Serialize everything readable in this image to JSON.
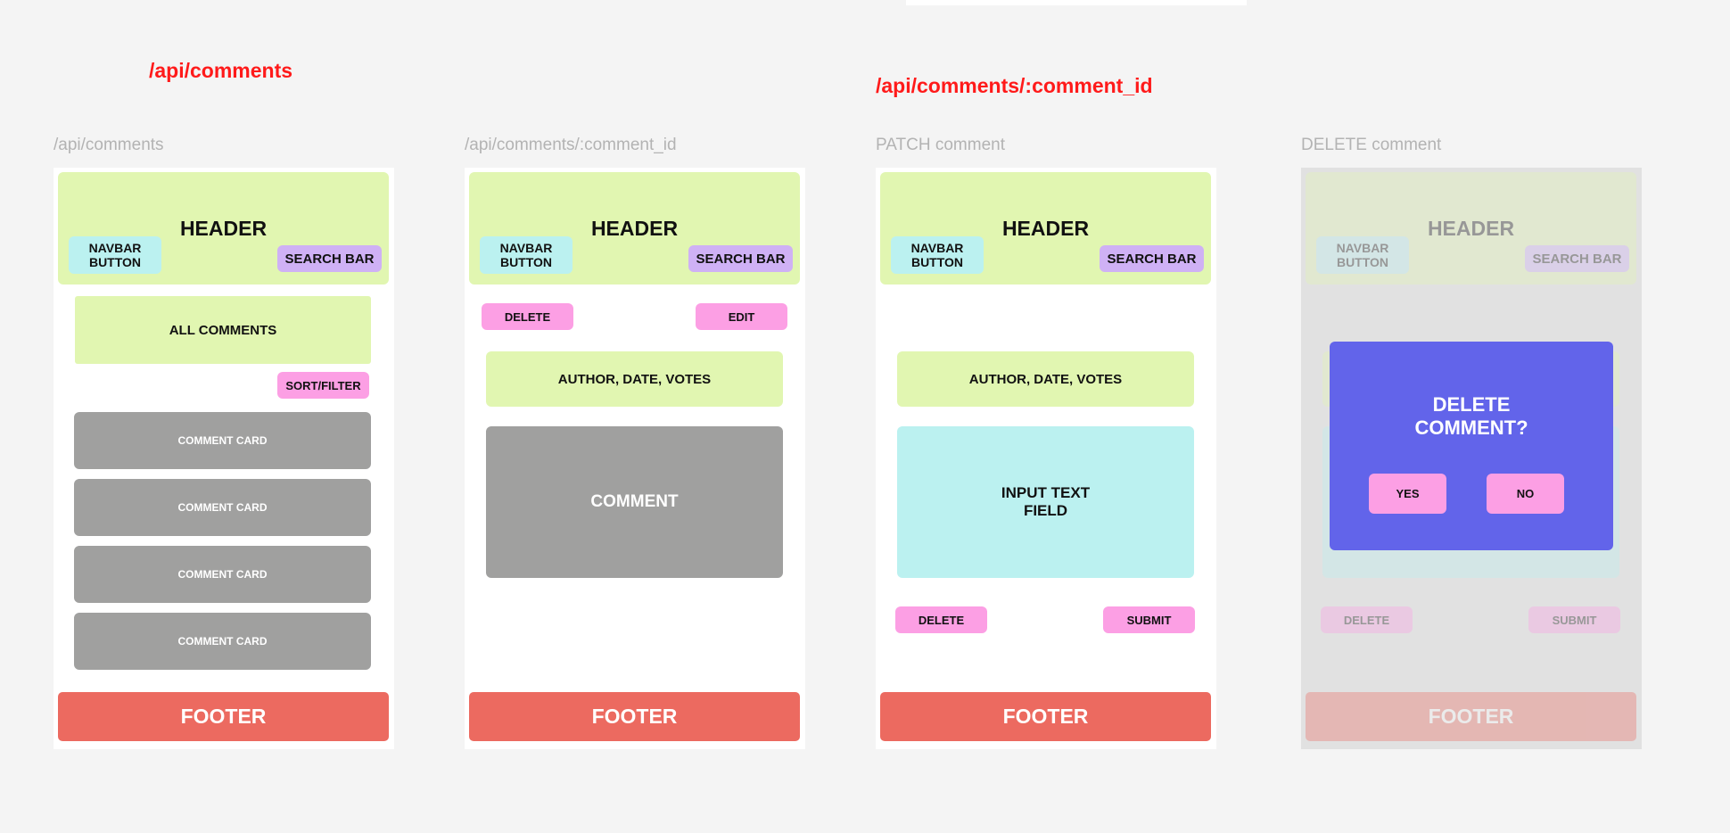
{
  "section_titles": {
    "left": "/api/comments",
    "right": "/api/comments/:comment_id"
  },
  "frames": {
    "list": {
      "label": "/api/comments",
      "header_title": "HEADER",
      "navbar_button": "NAVBAR BUTTON",
      "search_bar": "SEARCH BAR",
      "all_comments": "ALL COMMENTS",
      "sort_filter": "SORT/FILTER",
      "comment_cards": [
        "COMMENT CARD",
        "COMMENT CARD",
        "COMMENT CARD",
        "COMMENT CARD"
      ],
      "footer": "FOOTER"
    },
    "detail": {
      "label": "/api/comments/:comment_id",
      "header_title": "HEADER",
      "navbar_button": "NAVBAR BUTTON",
      "search_bar": "SEARCH BAR",
      "delete": "DELETE",
      "edit": "EDIT",
      "meta": "AUTHOR, DATE, VOTES",
      "comment": "COMMENT",
      "footer": "FOOTER"
    },
    "patch": {
      "label": "PATCH comment",
      "header_title": "HEADER",
      "navbar_button": "NAVBAR BUTTON",
      "search_bar": "SEARCH BAR",
      "meta": "AUTHOR, DATE, VOTES",
      "input_field": "INPUT TEXT FIELD",
      "delete": "DELETE",
      "submit": "SUBMIT",
      "footer": "FOOTER"
    },
    "delete": {
      "label": "DELETE comment",
      "header_title": "HEADER",
      "navbar_button": "NAVBAR BUTTON",
      "search_bar": "SEARCH BAR",
      "delete": "DELETE",
      "submit": "SUBMIT",
      "footer": "FOOTER",
      "modal_title": "DELETE COMMENT?",
      "yes": "YES",
      "no": "NO"
    }
  },
  "colors": {
    "canvas": "#f4f4f4",
    "section_title": "#ff1a1a",
    "header": "#e1f6b1",
    "navbar": "#bbf1f0",
    "search": "#cfb1f5",
    "pink_button": "#fc9fe4",
    "comment_gray": "#a0a09f",
    "footer": "#ec6a60",
    "modal": "#6264ea"
  }
}
